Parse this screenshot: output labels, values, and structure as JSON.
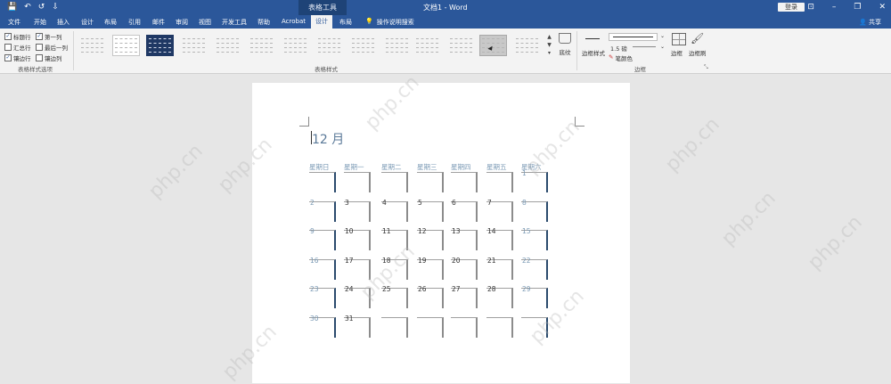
{
  "titlebar": {
    "quick_access": [
      "💾",
      "↶",
      "↺",
      "⇩"
    ],
    "context_tab_title": "表格工具",
    "document_title": "文档1  -  Word",
    "login_label": "登录",
    "window_buttons": [
      "⊡",
      "–",
      "❐",
      "✕"
    ]
  },
  "tabs": {
    "file": "文件",
    "home": "开始",
    "insert": "插入",
    "design_doc": "设计",
    "layout_doc": "布局",
    "references": "引用",
    "mailings": "邮件",
    "review": "审阅",
    "view": "视图",
    "developer": "开发工具",
    "help": "帮助",
    "acrobat": "Acrobat",
    "table_design": "设计",
    "table_layout": "布局",
    "tell_me": "操作说明搜索",
    "share": "共享"
  },
  "ribbon": {
    "style_options": {
      "header_row": "标题行",
      "first_column": "第一列",
      "total_row": "汇总行",
      "last_column": "最后一列",
      "banded_rows": "镶边行",
      "banded_columns": "镶边列",
      "group_label": "表格样式选项"
    },
    "table_styles_label": "表格样式",
    "shading_label": "底纹",
    "border_styles_label": "边框样式",
    "pen_weight": "1.5 磅",
    "pen_color": "笔颜色",
    "borders_label": "边框",
    "border_painter_label": "边框刷",
    "borders_group_label": "边框"
  },
  "document": {
    "month_title": "12  月",
    "weekdays": [
      "星期日",
      "星期一",
      "星期二",
      "星期三",
      "星期四",
      "星期五",
      "星期六"
    ],
    "weeks": [
      [
        "",
        "",
        "",
        "",
        "",
        "",
        "1"
      ],
      [
        "2",
        "3",
        "4",
        "5",
        "6",
        "7",
        "8"
      ],
      [
        "9",
        "10",
        "11",
        "12",
        "13",
        "14",
        "15"
      ],
      [
        "16",
        "17",
        "18",
        "19",
        "20",
        "21",
        "22"
      ],
      [
        "23",
        "24",
        "25",
        "26",
        "27",
        "28",
        "29"
      ],
      [
        "30",
        "31",
        "",
        "",
        "",
        "",
        ""
      ]
    ]
  },
  "watermark": "php.cn"
}
